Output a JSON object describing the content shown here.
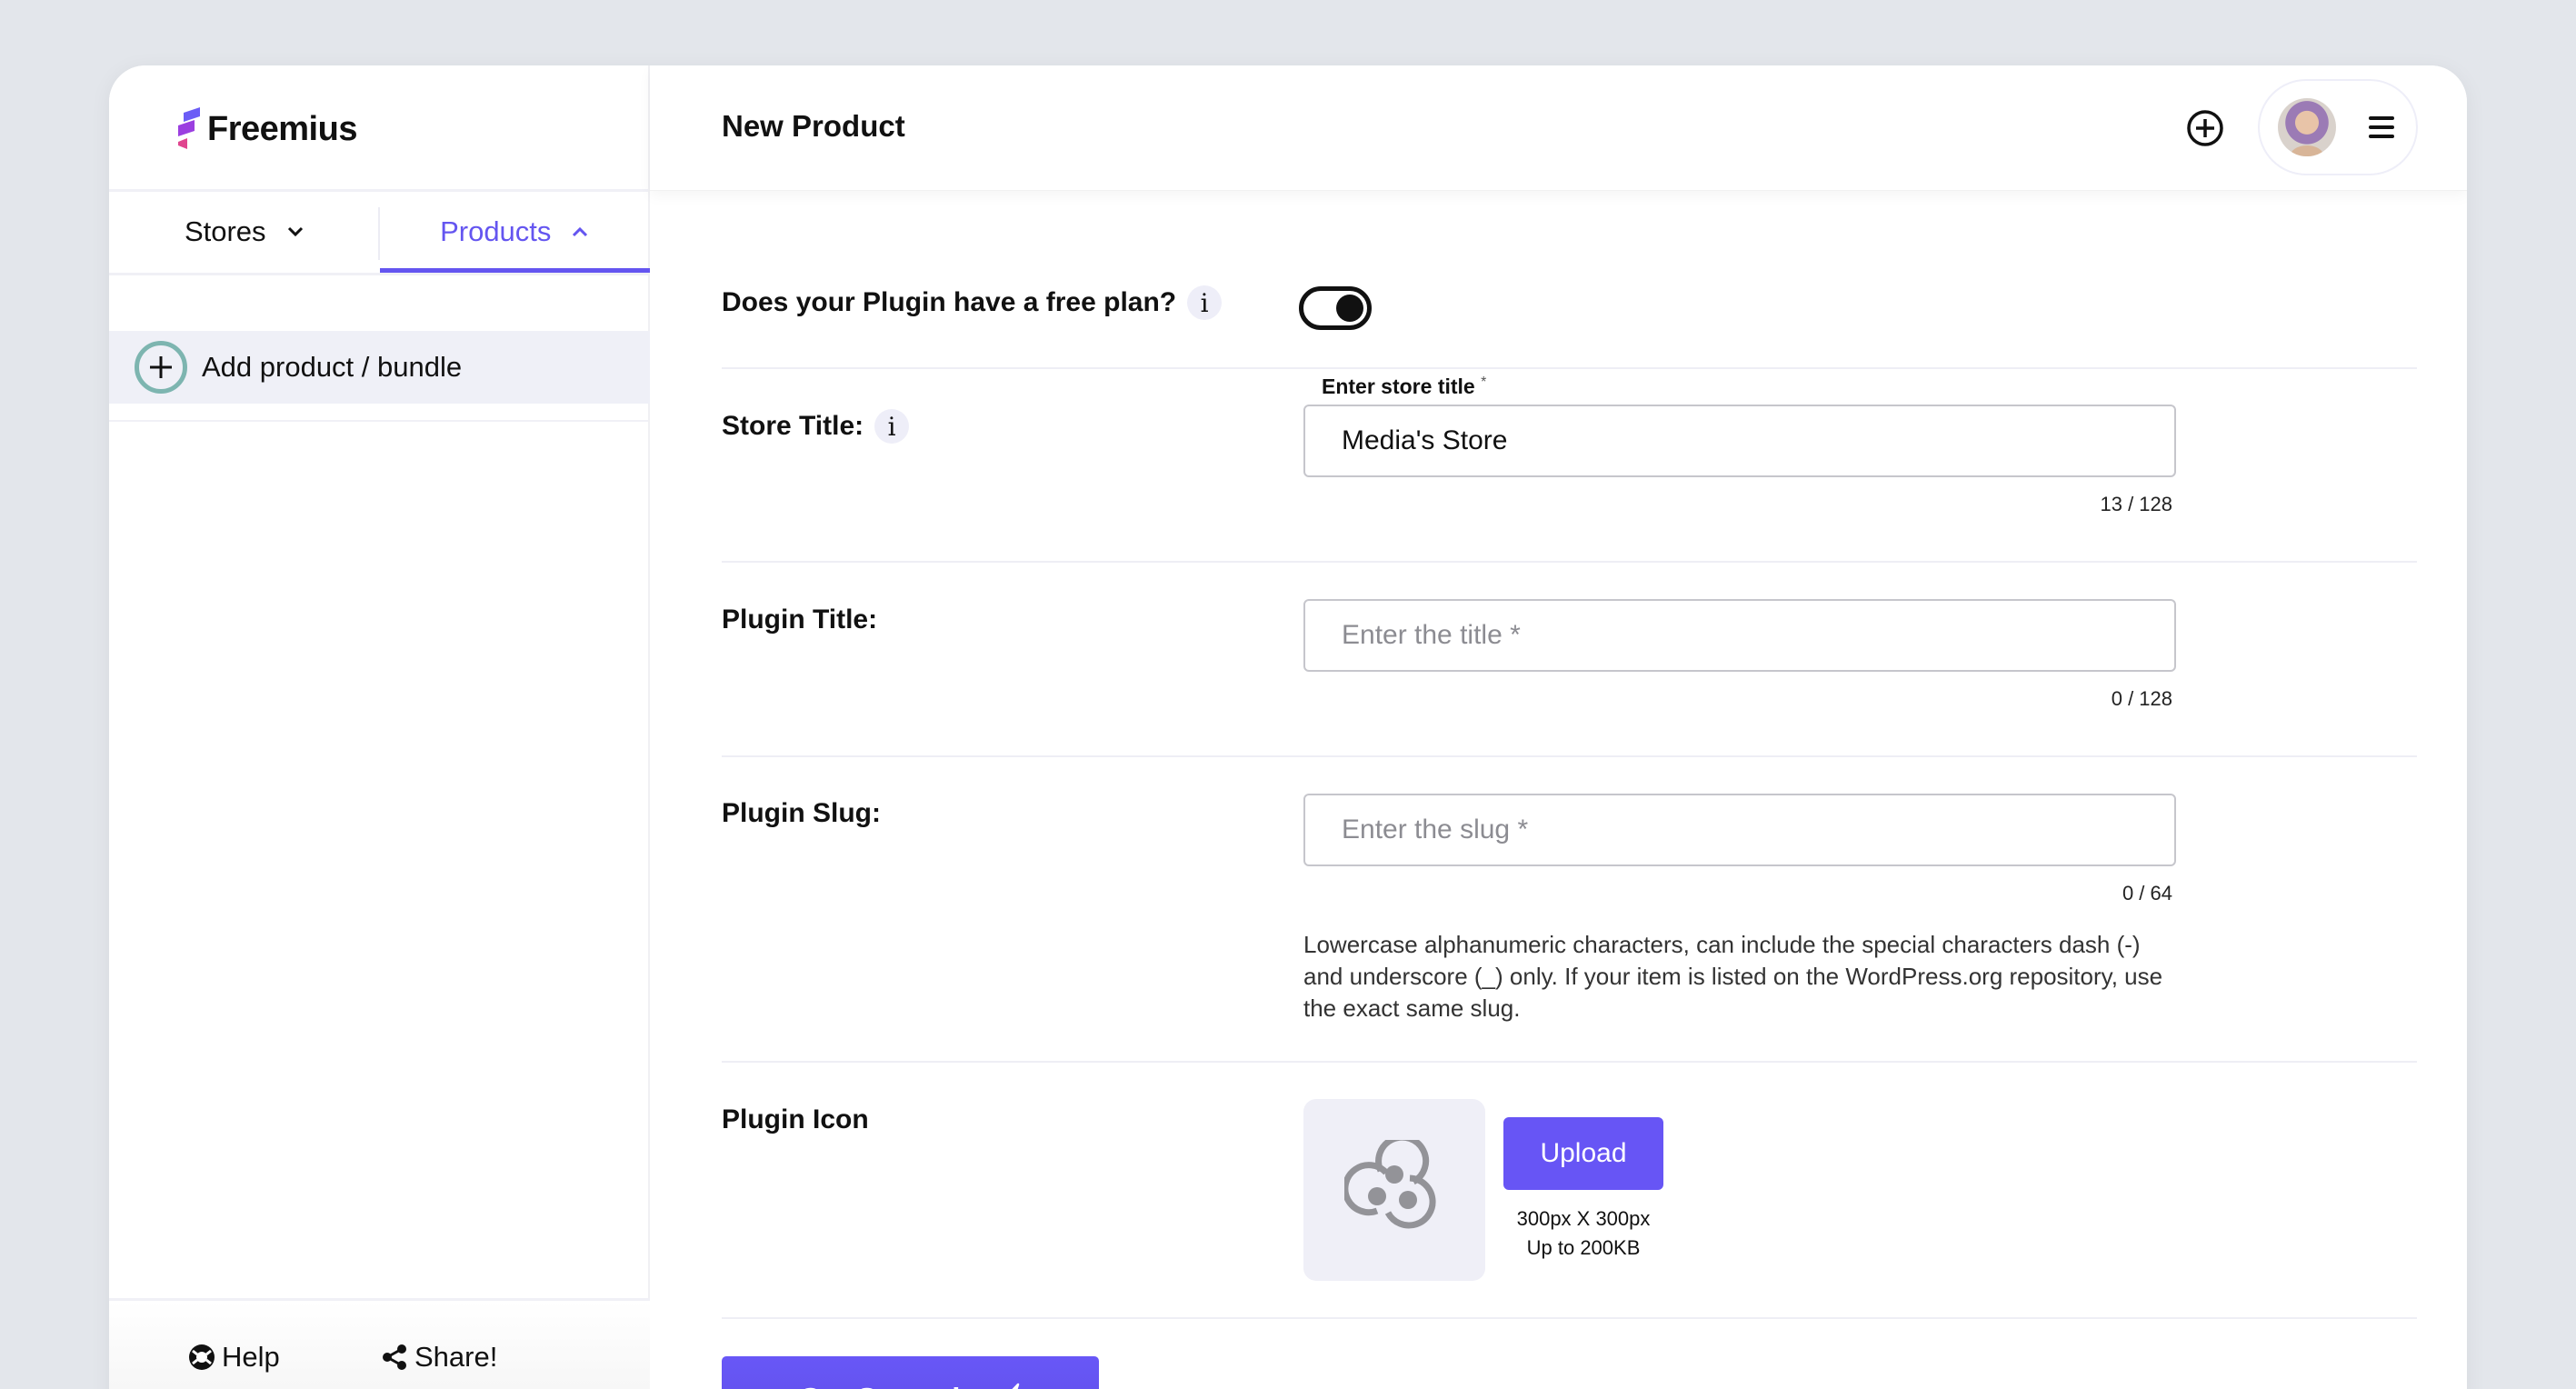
{
  "brand": {
    "name": "Freemius",
    "accent": "#6455f0",
    "logo_colors": [
      "#6b5cf6",
      "#9b3fe0",
      "#e0458f"
    ]
  },
  "sidebar": {
    "tabs": [
      {
        "label": "Stores",
        "icon": "chevron-down-icon",
        "active": false
      },
      {
        "label": "Products",
        "icon": "chevron-up-icon",
        "active": true
      }
    ],
    "add_item": {
      "label": "Add product / bundle",
      "icon": "plus-circle-icon"
    },
    "footer": {
      "help": {
        "label": "Help",
        "icon": "lifebuoy-icon"
      },
      "share": {
        "label": "Share!",
        "icon": "share-icon"
      }
    }
  },
  "header": {
    "title": "New Product",
    "add_icon": "plus-circle-icon",
    "menu_icon": "hamburger-icon",
    "avatar": "user-avatar"
  },
  "form": {
    "free_plan": {
      "label": "Does your Plugin have a free plan?",
      "info": "i",
      "toggle_on": true
    },
    "store_title": {
      "label": "Store Title:",
      "info": "i",
      "field_label": "Enter store title",
      "required_mark": "*",
      "value": "Media's Store",
      "counter": "13 / 128"
    },
    "plugin_title": {
      "label": "Plugin Title:",
      "placeholder": "Enter the title *",
      "value": "",
      "counter": "0 / 128"
    },
    "plugin_slug": {
      "label": "Plugin Slug:",
      "placeholder": "Enter the slug *",
      "value": "",
      "counter": "0 / 64",
      "help": "Lowercase alphanumeric characters, can include the special characters dash (-) and underscore (_) only. If your item is listed on the WordPress.org repository, use the exact same slug."
    },
    "plugin_icon": {
      "label": "Plugin Icon",
      "placeholder_icon": "plugin-placeholder-icon",
      "upload_label": "Upload",
      "size_hint": "300px X 300px",
      "weight_hint": "Up to 200KB"
    },
    "submit": {
      "label": "Get Started",
      "icon": "paper-plane-icon"
    }
  }
}
